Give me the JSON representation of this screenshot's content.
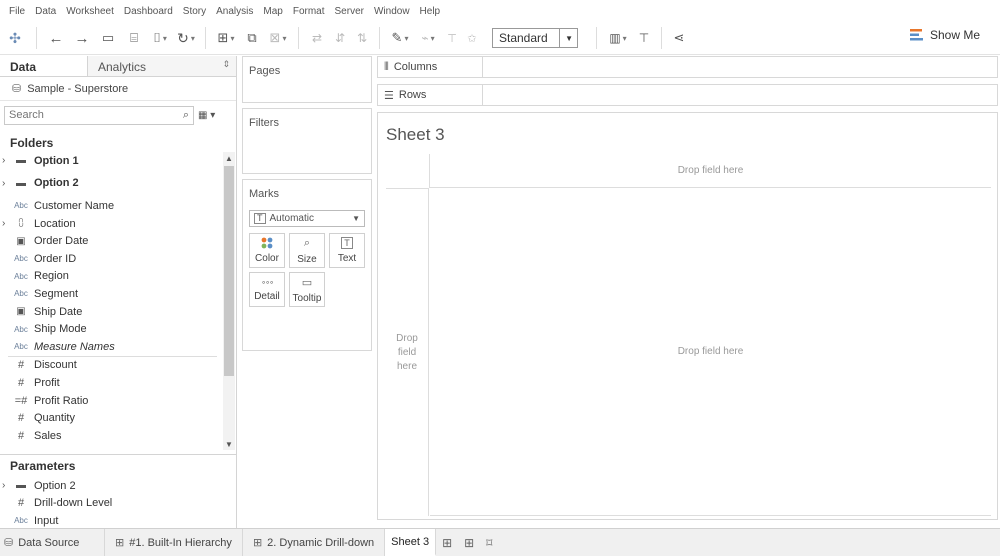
{
  "menu": [
    "File",
    "Data",
    "Worksheet",
    "Dashboard",
    "Story",
    "Analysis",
    "Map",
    "Format",
    "Server",
    "Window",
    "Help"
  ],
  "toolbar": {
    "fit_value": "Standard",
    "show_me_label": "Show Me",
    "icons": [
      "tableau-logo-icon",
      "undo-icon",
      "redo-icon",
      "save-icon",
      "new-datasource-icon",
      "pause-updates-icon",
      "refresh-icon",
      "new-worksheet-icon",
      "duplicate-icon",
      "clear-icon",
      "swap-icon",
      "sort-ascending-icon",
      "sort-descending-icon",
      "highlight-icon",
      "group-icon",
      "labels-icon",
      "fix-axes-icon",
      "chart-size-icon",
      "presentation-icon",
      "share-icon"
    ]
  },
  "left_pane": {
    "tab_data": "Data",
    "tab_analytics": "Analytics",
    "datasource": "Sample - Superstore",
    "search_placeholder": "Search",
    "folders_header": "Folders",
    "fields": [
      {
        "label": "Option 1",
        "icon": "folder-icon",
        "expand": "›",
        "type": "folder"
      },
      {
        "label": "Option 2",
        "icon": "folder-icon",
        "expand": "›",
        "type": "folder"
      },
      {
        "label": "Customer Name",
        "icon": "Abc",
        "expand": "",
        "type": "dim"
      },
      {
        "label": "Location",
        "icon": "hierarchy-icon",
        "expand": "›",
        "type": "dim"
      },
      {
        "label": "Order Date",
        "icon": "calendar-icon",
        "expand": "",
        "type": "dim"
      },
      {
        "label": "Order ID",
        "icon": "Abc",
        "expand": "",
        "type": "dim"
      },
      {
        "label": "Region",
        "icon": "Abc",
        "expand": "",
        "type": "dim"
      },
      {
        "label": "Segment",
        "icon": "Abc",
        "expand": "",
        "type": "dim"
      },
      {
        "label": "Ship Date",
        "icon": "calendar-icon",
        "expand": "",
        "type": "dim"
      },
      {
        "label": "Ship Mode",
        "icon": "Abc",
        "expand": "",
        "type": "dim"
      },
      {
        "label": "Measure Names",
        "icon": "Abc",
        "expand": "",
        "type": "italic"
      }
    ],
    "measures": [
      {
        "label": "Discount",
        "icon": "#"
      },
      {
        "label": "Profit",
        "icon": "#"
      },
      {
        "label": "Profit Ratio",
        "icon": "=#"
      },
      {
        "label": "Quantity",
        "icon": "#"
      },
      {
        "label": "Sales",
        "icon": "#"
      }
    ],
    "parameters_header": "Parameters",
    "parameters": [
      {
        "label": "Option 2",
        "icon": "folder-icon",
        "expand": "›"
      },
      {
        "label": "Drill-down Level",
        "icon": "#",
        "expand": ""
      },
      {
        "label": "Input",
        "icon": "Abc",
        "expand": ""
      }
    ]
  },
  "shelves": {
    "pages": "Pages",
    "filters": "Filters",
    "marks": "Marks",
    "mark_type": "Automatic",
    "mark_buttons": [
      "Color",
      "Size",
      "Text",
      "Detail",
      "Tooltip"
    ],
    "columns": "Columns",
    "rows": "Rows"
  },
  "sheet": {
    "title": "Sheet 3",
    "drop_top": "Drop field here",
    "drop_left": "Drop\nfield\nhere",
    "drop_main": "Drop field here"
  },
  "bottom_tabs": {
    "datasource": "Data Source",
    "sheets": [
      "#1. Built-In Hierarchy",
      "2. Dynamic Drill-down",
      "Sheet 3"
    ],
    "active": "Sheet 3"
  }
}
